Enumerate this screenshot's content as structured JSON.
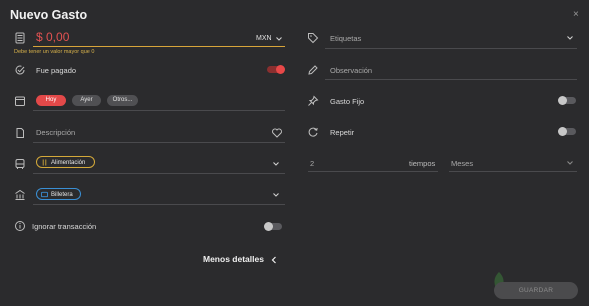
{
  "modal": {
    "title": "Nuevo Gasto",
    "close_label": "×"
  },
  "left": {
    "amount_value": "$ 0,00",
    "currency": "MXN",
    "amount_error": "Debe tener un valor mayor que 0",
    "paid_label": "Fue pagado",
    "paid_on": true,
    "date_pills": [
      {
        "label": "Hoy",
        "active": true
      },
      {
        "label": "Ayer",
        "active": false
      },
      {
        "label": "Otros...",
        "active": false
      }
    ],
    "description_placeholder": "Descripción",
    "category_label": "Alimentación",
    "account_label": "Billetera",
    "ignore_label": "Ignorar transacción",
    "ignore_on": false
  },
  "right": {
    "tags_placeholder": "Etiquetas",
    "observation_placeholder": "Observación",
    "fixed_label": "Gasto Fijo",
    "fixed_on": false,
    "repeat_label": "Repetir",
    "repeat_on": false,
    "repeat_count": "2",
    "repeat_unit_label": "tiempos",
    "repeat_period": "Meses"
  },
  "footer": {
    "less_details": "Menos detalles",
    "save_label": "GUARDAR"
  },
  "colors": {
    "accent": "#e34949",
    "warning": "#d8b24b",
    "category_border": "#d4a93a",
    "account_border": "#3a8fd4"
  },
  "icons": [
    "calculator-icon",
    "check-circle-icon",
    "calendar-icon",
    "document-icon",
    "heart-icon",
    "category-icon",
    "bank-icon",
    "info-icon",
    "tag-icon",
    "pencil-icon",
    "pin-icon",
    "repeat-icon",
    "chevron-down-icon",
    "chevron-left-icon",
    "close-icon"
  ]
}
